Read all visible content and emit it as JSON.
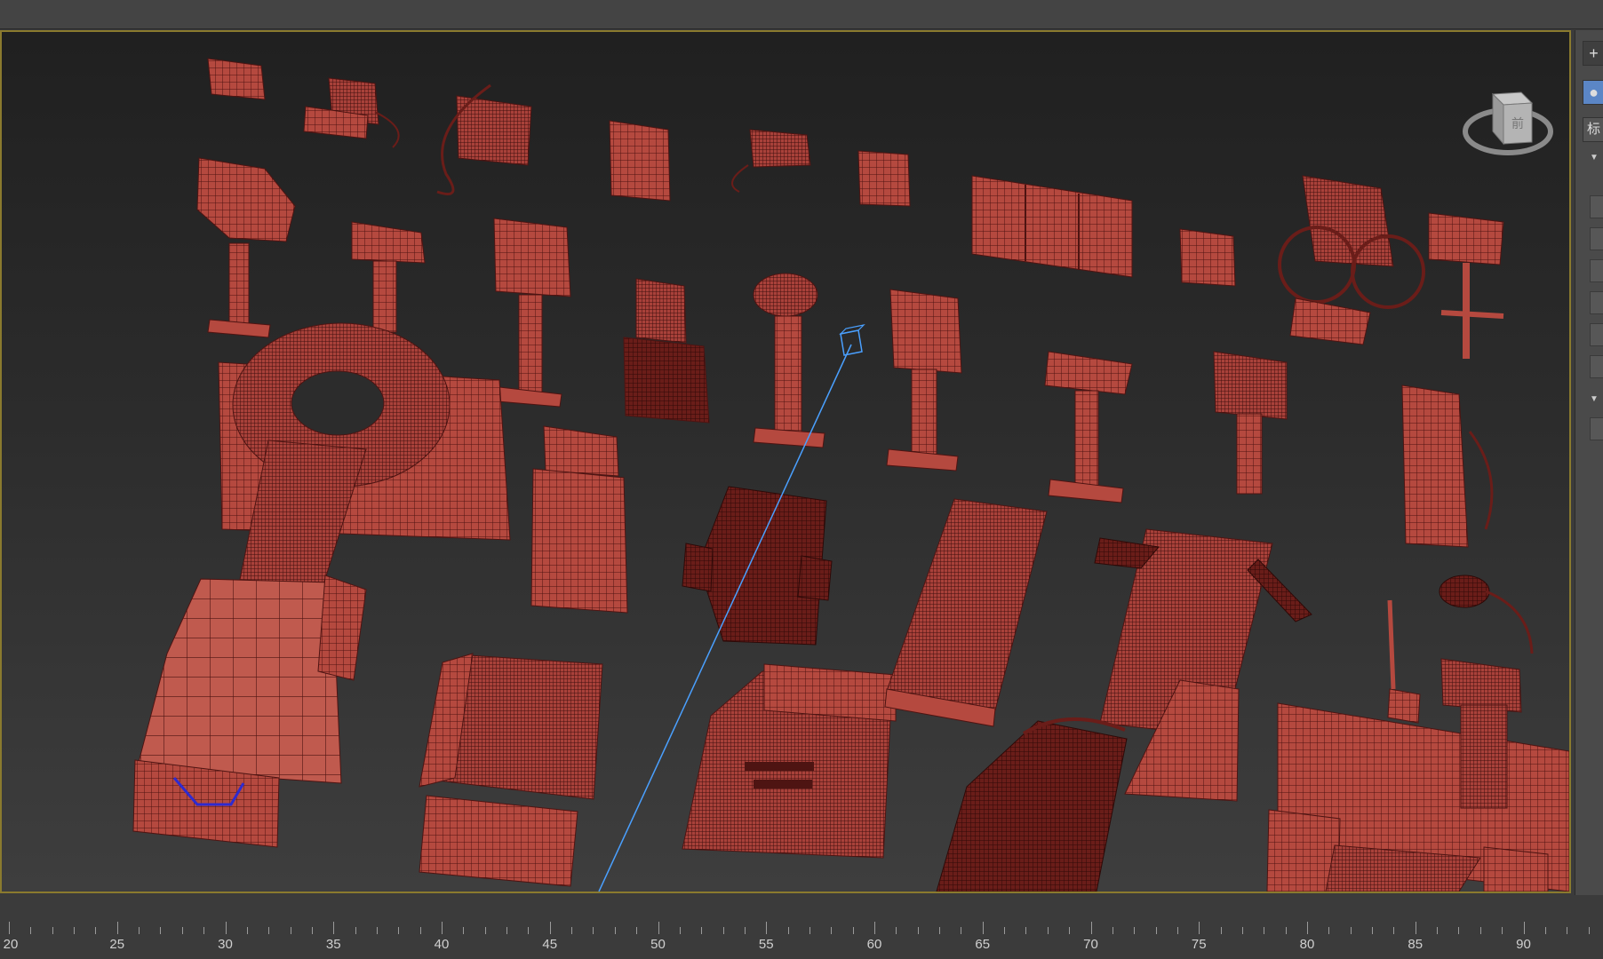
{
  "app": {
    "accent_color": "#8a7a2e",
    "model_color": "#b5493f",
    "wire_color": "#4e1412",
    "selection_line_color": "#4aa0ff"
  },
  "right_panel": {
    "plus_label": "+",
    "active_label": "●",
    "standard_label": "标",
    "collapse_arrow": "▼"
  },
  "viewcube": {
    "icon": "viewcube-icon",
    "face_label": "前"
  },
  "timeline": {
    "ticks": [
      "20",
      "25",
      "30",
      "35",
      "40",
      "45",
      "50",
      "55",
      "60",
      "65",
      "70",
      "75",
      "80",
      "85",
      "90"
    ]
  }
}
